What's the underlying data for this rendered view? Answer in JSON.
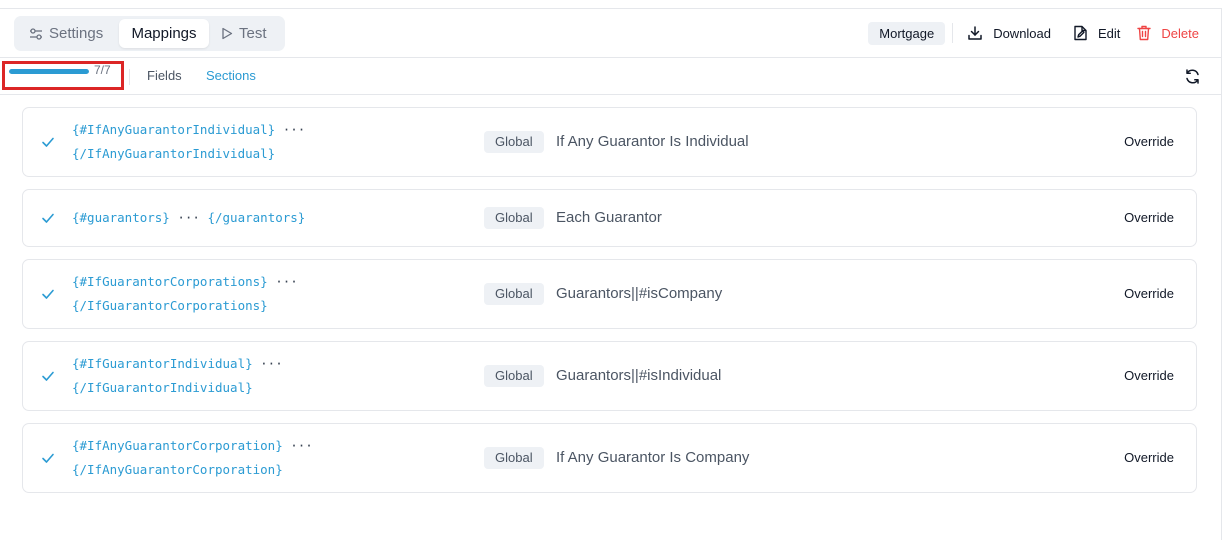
{
  "header": {
    "tabs": [
      {
        "label": "Settings",
        "icon": "sliders-icon"
      },
      {
        "label": "Mappings",
        "active": true
      },
      {
        "label": "Test",
        "icon": "play-icon"
      }
    ],
    "tag": "Mortgage",
    "actions": {
      "download": "Download",
      "edit": "Edit",
      "delete": "Delete"
    }
  },
  "subbar": {
    "progress_text": "7/7",
    "progress_fraction": 1.0,
    "fields_label": "Fields",
    "sections_label": "Sections"
  },
  "rows": [
    {
      "code_line1": "{#IfAnyGuarantorIndividual}",
      "dots": "···",
      "code_line2": "{/IfAnyGuarantorIndividual}",
      "scope": "Global",
      "description": "If Any Guarantor Is Individual",
      "action": "Override"
    },
    {
      "code_line1": "{#guarantors}",
      "dots": "···",
      "code_line2": "{/guarantors}",
      "scope": "Global",
      "description": "Each Guarantor",
      "action": "Override"
    },
    {
      "code_line1": "{#IfGuarantorCorporations}",
      "dots": "···",
      "code_line2": "{/IfGuarantorCorporations}",
      "scope": "Global",
      "description": "Guarantors||#isCompany",
      "action": "Override"
    },
    {
      "code_line1": "{#IfGuarantorIndividual}",
      "dots": "···",
      "code_line2": "{/IfGuarantorIndividual}",
      "scope": "Global",
      "description": "Guarantors||#isIndividual",
      "action": "Override"
    },
    {
      "code_line1": "{#IfAnyGuarantorCorporation}",
      "dots": "···",
      "code_line2": "{/IfAnyGuarantorCorporation}",
      "scope": "Global",
      "description": "If Any Guarantor Is Company",
      "action": "Override"
    }
  ],
  "colors": {
    "accent": "#2b9bd3",
    "danger": "#ef4444",
    "highlight_box": "#dc2626"
  }
}
